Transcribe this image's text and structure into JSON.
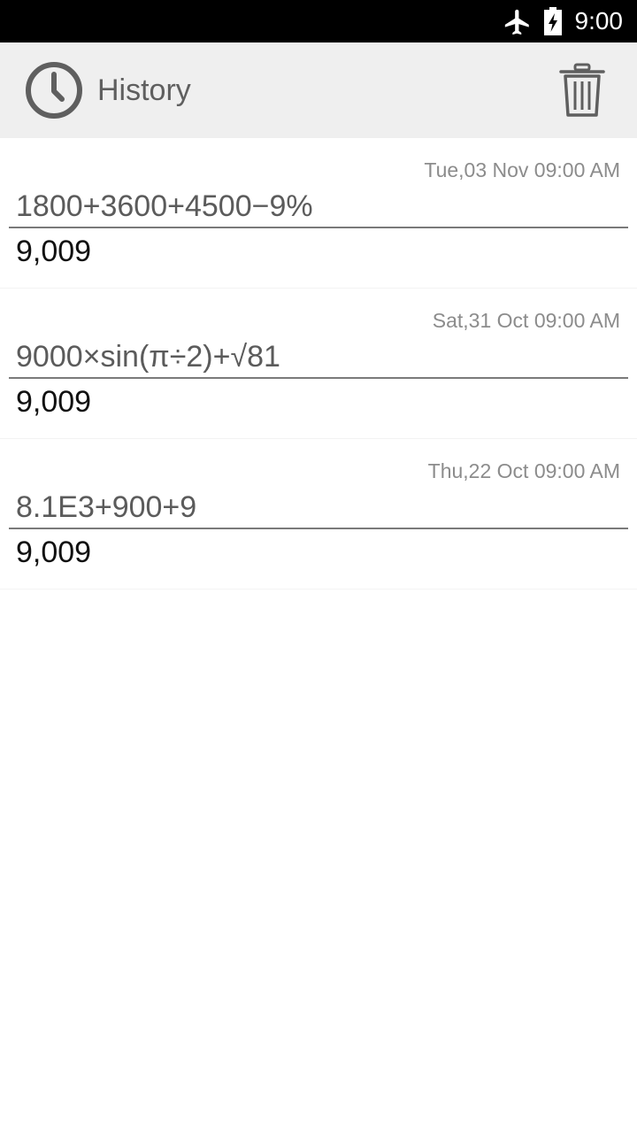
{
  "status_bar": {
    "time": "9:00",
    "icons": [
      "airplane-mode-icon",
      "battery-charging-icon"
    ]
  },
  "app_bar": {
    "title": "History",
    "icons": [
      "history-clock-icon",
      "trash-icon"
    ]
  },
  "history": [
    {
      "date": "Tue,03 Nov 09:00 AM",
      "expression": "1800+3600+4500−9%",
      "result": "9,009"
    },
    {
      "date": "Sat,31 Oct 09:00 AM",
      "expression": "9000×sin(π÷2)+√81",
      "result": "9,009"
    },
    {
      "date": "Thu,22 Oct 09:00 AM",
      "expression": "8.1E3+900+9",
      "result": "9,009"
    }
  ],
  "colors": {
    "status_bar": "#000000",
    "app_bar": "#efefef",
    "icon_gray": "#5f5f5f",
    "date_text": "#8c8c8c",
    "result_text": "#111111"
  }
}
